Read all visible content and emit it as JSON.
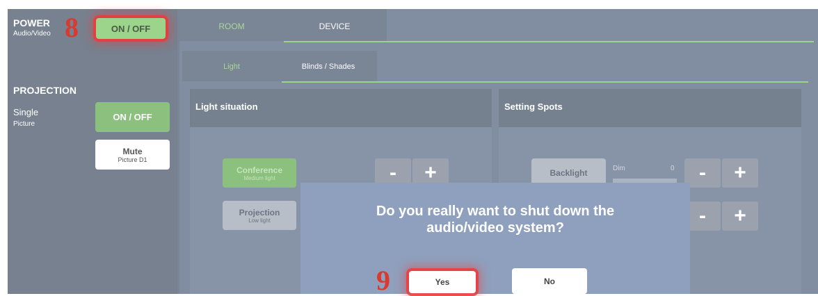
{
  "sidebar": {
    "power_title": "POWER",
    "power_sub": "Audio/Video",
    "power_button": "ON / OFF",
    "projection_title": "PROJECTION",
    "single_title": "Single",
    "single_sub": "Picture",
    "single_button": "ON / OFF",
    "mute_title": "Mute",
    "mute_sub": "Picture D1"
  },
  "tabs": {
    "room": "ROOM",
    "device": "DEVICE"
  },
  "subtabs": {
    "light": "Light",
    "blinds": "Blinds / Shades"
  },
  "panels": {
    "light_situation": "Light situation",
    "setting_spots": "Setting Spots",
    "conference_title": "Conference",
    "conference_sub": "Medium light",
    "projection_title": "Projection",
    "projection_sub": "Low light",
    "backlight": "Backlight",
    "dim_label": "Dim",
    "dim_value": "0",
    "minus": "-",
    "plus": "+"
  },
  "dialog": {
    "line1": "Do you really want to shut down the",
    "line2": "audio/video system?",
    "yes": "Yes",
    "no": "No"
  },
  "annotations": {
    "step8": "8",
    "step9": "9"
  },
  "colors": {
    "accent_green": "#9bd48a",
    "annotation_red": "#d83a2e",
    "dialog_bg": "#8ea0bd"
  }
}
